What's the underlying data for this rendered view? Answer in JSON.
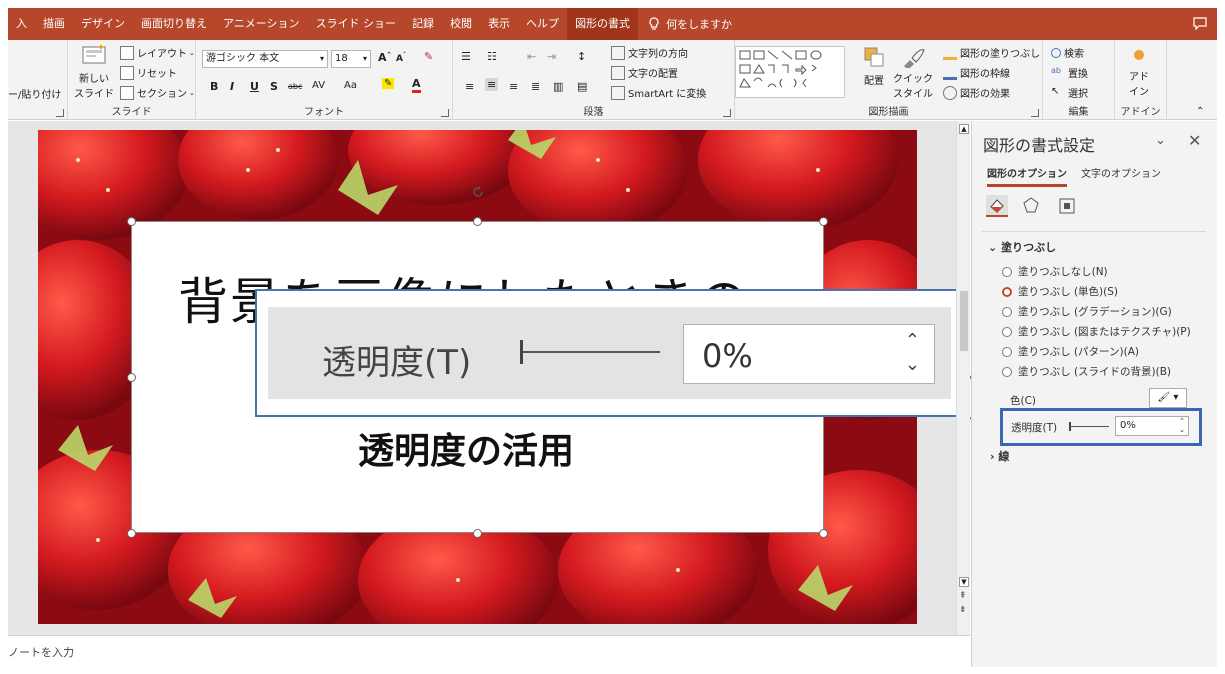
{
  "tabs": [
    {
      "label": "入"
    },
    {
      "label": "描画"
    },
    {
      "label": "デザイン"
    },
    {
      "label": "画面切り替え"
    },
    {
      "label": "アニメーション"
    },
    {
      "label": "スライド ショー"
    },
    {
      "label": "記録"
    },
    {
      "label": "校閲"
    },
    {
      "label": "表示"
    },
    {
      "label": "ヘルプ"
    },
    {
      "label": "図形の書式",
      "active": true
    }
  ],
  "tell_me": "何をしますか",
  "ribbon": {
    "clipboard": {
      "paste_label": "ー/貼り付け"
    },
    "slides": {
      "new_slide_line1": "新しい",
      "new_slide_line2": "スライド",
      "layout": "レイアウト",
      "reset": "リセット",
      "section": "セクション",
      "group_label": "スライド"
    },
    "font": {
      "font_name": "游ゴシック 本文",
      "font_size": "18",
      "bold": "B",
      "italic": "I",
      "underline": "U",
      "shadow": "S",
      "strike": "abc",
      "spacing": "AV",
      "case": "Aa",
      "group_label": "フォント"
    },
    "paragraph": {
      "text_direction": "文字列の方向",
      "align_text": "文字の配置",
      "smartart": "SmartArt に変換",
      "group_label": "段落"
    },
    "drawing": {
      "arrange": "配置",
      "quick_style_line1": "クイック",
      "quick_style_line2": "スタイル",
      "shape_fill": "図形の塗りつぶし",
      "shape_outline": "図形の枠線",
      "shape_effects": "図形の効果",
      "group_label": "図形描画"
    },
    "editing": {
      "find": "検索",
      "replace": "置換",
      "select": "選択",
      "group_label": "編集"
    },
    "addins": {
      "line1": "アド",
      "line2": "イン",
      "group_label": "アドイン"
    }
  },
  "slide": {
    "title": "背景を画像にしたときの",
    "subtitle": "透明度の活用"
  },
  "callout": {
    "label": "透明度(T)",
    "value": "0%"
  },
  "notes_placeholder": "ノートを入力",
  "pane": {
    "title": "図形の書式設定",
    "tabs": [
      "図形のオプション",
      "文字のオプション"
    ],
    "fill_section": "塗りつぶし",
    "fill_options": [
      {
        "label": "塗りつぶしなし(N)",
        "selected": false
      },
      {
        "label": "塗りつぶし (単色)(S)",
        "selected": true
      },
      {
        "label": "塗りつぶし (グラデーション)(G)",
        "selected": false
      },
      {
        "label": "塗りつぶし (図またはテクスチャ)(P)",
        "selected": false
      },
      {
        "label": "塗りつぶし (パターン)(A)",
        "selected": false
      },
      {
        "label": "塗りつぶし (スライドの背景)(B)",
        "selected": false
      }
    ],
    "color_label": "色(C)",
    "transparency_label": "透明度(T)",
    "transparency_value": "0%",
    "line_section": "線"
  },
  "colors": {
    "accent": "#b7472a",
    "highlight_border": "#3e66b0"
  }
}
